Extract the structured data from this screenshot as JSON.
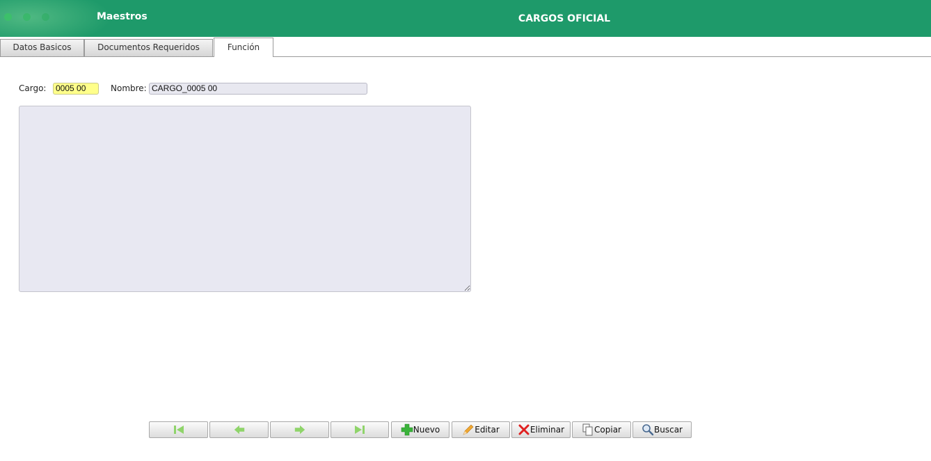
{
  "header": {
    "app_title": "Maestros",
    "page_title": "CARGOS OFICIAL",
    "bg_color": "#1e9a6a"
  },
  "tabs": [
    {
      "label": "Datos Basicos",
      "active": false
    },
    {
      "label": "Documentos Requeridos",
      "active": false
    },
    {
      "label": "Función",
      "active": true
    }
  ],
  "form": {
    "cargo_label": "Cargo:",
    "cargo_value": "0005 00",
    "nombre_label": "Nombre:",
    "nombre_value": "CARGO_0005 00",
    "funcion_text": ""
  },
  "toolbar": {
    "first_icon": "first-record-icon",
    "prev_icon": "prev-arrow-icon",
    "next_icon": "next-arrow-icon",
    "last_icon": "last-record-icon",
    "nuevo_label": "Nuevo",
    "editar_label": "Editar",
    "eliminar_label": "Eliminar",
    "copiar_label": "Copiar",
    "buscar_label": "Buscar"
  }
}
